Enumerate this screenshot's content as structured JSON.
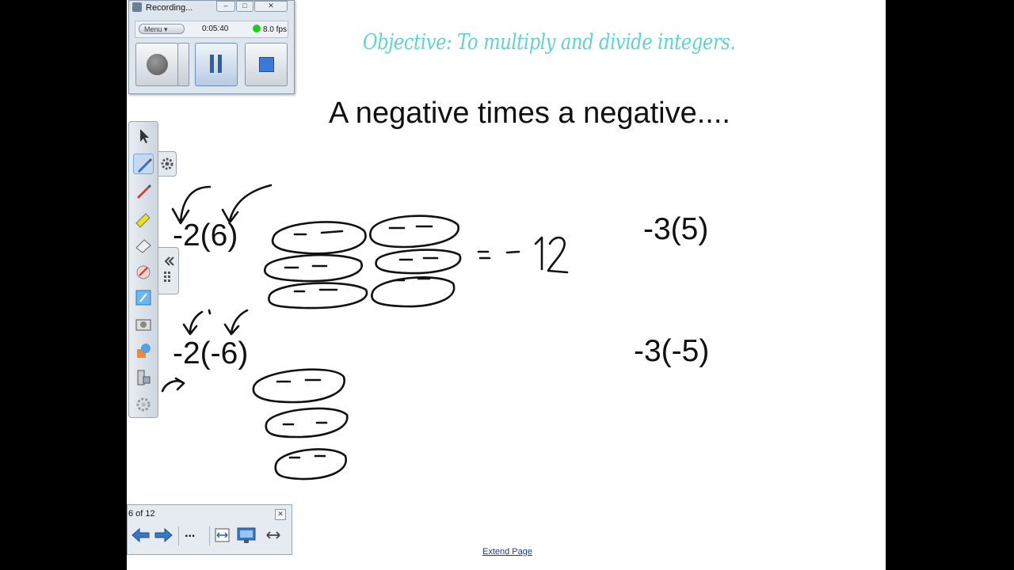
{
  "recorder": {
    "title": "Recording...",
    "menu_label": "Menu",
    "elapsed": "0:05:40",
    "fps": "8.0 fps",
    "status_color": "#18d018"
  },
  "slide": {
    "objective": "Objective:  To multiply and divide integers.",
    "heading": "A negative times a negative....",
    "expressions": [
      "-2(6)",
      "-2(-6)",
      "-3(5)",
      "-3(-5)"
    ],
    "handwritten_result": "= -12",
    "extend_link": "Extend Page",
    "objective_color": "#5fd3cc"
  },
  "page_navigator": {
    "page_label": "6 of 12",
    "more_label": "..."
  },
  "tools": [
    "select-arrow-icon",
    "pen-icon",
    "creative-pen-icon",
    "highlighter-icon",
    "eraser-icon",
    "magic-pen-icon",
    "text-tool-icon",
    "screen-capture-icon",
    "fill-shapes-icon",
    "table-tool-icon",
    "settings-icon"
  ]
}
